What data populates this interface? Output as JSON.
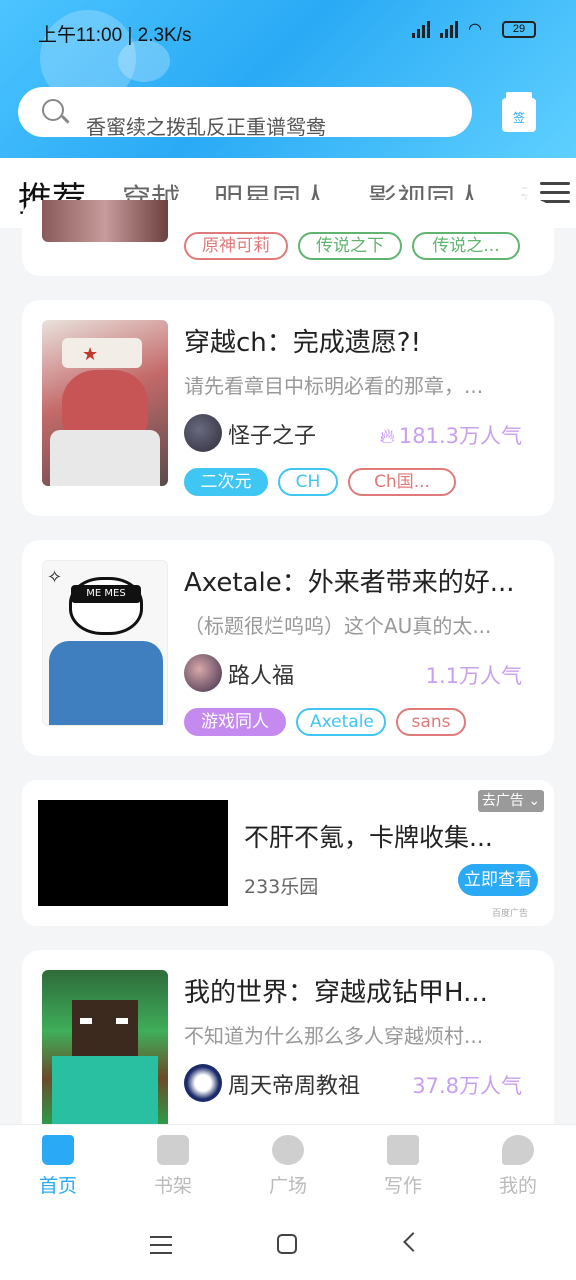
{
  "status": {
    "time": "上午11:00 | 2.3K/s",
    "battery": "29",
    "signal1": "HD",
    "signal2": "HD"
  },
  "search": {
    "placeholder": "香蜜续之拨乱反正重谱鸳鸯"
  },
  "gift": {
    "label": "签"
  },
  "tabs": [
    {
      "label": "推荐",
      "active": true
    },
    {
      "label": "穿越"
    },
    {
      "label": "明星同人"
    },
    {
      "label": "影视同人"
    },
    {
      "label": "动"
    }
  ],
  "top_card": {
    "tags": [
      {
        "label": "原神可莉",
        "color": "#e07a7a"
      },
      {
        "label": "传说之下",
        "color": "#5fb56f"
      },
      {
        "label": "传说之...",
        "color": "#5fb56f"
      }
    ]
  },
  "cards": [
    {
      "title": "穿越ch：完成遗愿?!",
      "desc": "请先看章目中标明必看的那章，...",
      "author": "怪子之子",
      "popularity": "181.3万人气",
      "hot": true,
      "tags": [
        {
          "label": "二次元",
          "style": "filled",
          "color": "#3fc6f2"
        },
        {
          "label": "CH",
          "style": "outline",
          "color": "#3fc6f2"
        },
        {
          "label": "Ch国...",
          "style": "outline",
          "color": "#e07a7a"
        }
      ]
    },
    {
      "title": "Axetale：外来者带来的好...",
      "desc": "（标题很烂呜呜）这个AU真的太...",
      "author": "路人福",
      "popularity": "1.1万人气",
      "hot": false,
      "tags": [
        {
          "label": "游戏同人",
          "style": "filled",
          "color": "#c58af0"
        },
        {
          "label": "Axetale",
          "style": "outline",
          "color": "#3fc6f2"
        },
        {
          "label": "sans",
          "style": "outline",
          "color": "#e07a7a"
        }
      ]
    },
    {
      "title": "我的世界：穿越成钻甲H...",
      "desc": "不知道为什么那么多人穿越烦村...",
      "author": "周天帝周教祖",
      "popularity": "37.8万人气",
      "hot": false
    }
  ],
  "ad": {
    "title": "不肝不氪，卡牌收集...",
    "source": "233乐园",
    "close": "去广告",
    "button": "立即查看",
    "label": "百度广告"
  },
  "bottom_nav": [
    {
      "label": "首页",
      "icon": "home-icon",
      "active": true
    },
    {
      "label": "书架",
      "icon": "bookshelf-icon"
    },
    {
      "label": "广场",
      "icon": "planet-icon"
    },
    {
      "label": "写作",
      "icon": "pencil-icon"
    },
    {
      "label": "我的",
      "icon": "chat-bubble-icon"
    }
  ],
  "colors": {
    "accent": "#2aaaf5",
    "tab_underline": "#b76bff",
    "popularity": "#c9a0ef"
  }
}
